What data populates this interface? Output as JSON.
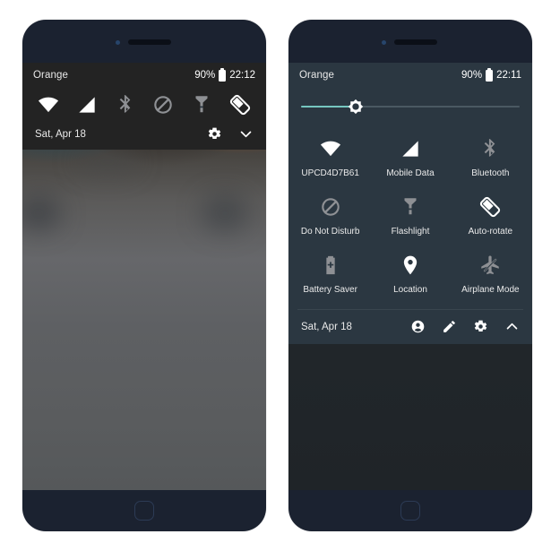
{
  "phones": {
    "left": {
      "name": "collapsed-quick-settings",
      "statusbar": {
        "carrier": "Orange",
        "battery_percent": "90%",
        "battery_icon": "battery-icon",
        "clock": "22:12"
      },
      "quick_icons": [
        {
          "name": "wifi-icon",
          "label": "Wi-Fi",
          "active": true
        },
        {
          "name": "signal-icon",
          "label": "Mobile Data",
          "active": true
        },
        {
          "name": "bluetooth-icon",
          "label": "Bluetooth",
          "active": false
        },
        {
          "name": "do-not-disturb-icon",
          "label": "Do Not Disturb",
          "active": false
        },
        {
          "name": "flashlight-icon",
          "label": "Flashlight",
          "active": false
        },
        {
          "name": "auto-rotate-icon",
          "label": "Auto-rotate",
          "active": true
        }
      ],
      "footer": {
        "date": "Sat, Apr 18",
        "actions": [
          {
            "name": "gear-icon",
            "label": "Settings"
          },
          {
            "name": "chevron-down-icon",
            "label": "Expand"
          }
        ]
      }
    },
    "right": {
      "name": "expanded-quick-settings",
      "statusbar": {
        "carrier": "Orange",
        "battery_percent": "90%",
        "battery_icon": "battery-icon",
        "clock": "22:11"
      },
      "brightness": {
        "name": "brightness-slider",
        "icon": "brightness-sun-icon",
        "value_percent": 25
      },
      "tiles": [
        {
          "name": "tile-wifi",
          "icon": "wifi-icon",
          "label": "UPCD4D7B61",
          "active": true
        },
        {
          "name": "tile-mobile-data",
          "icon": "signal-icon",
          "label": "Mobile Data",
          "active": true
        },
        {
          "name": "tile-bluetooth",
          "icon": "bluetooth-icon",
          "label": "Bluetooth",
          "active": false
        },
        {
          "name": "tile-do-not-disturb",
          "icon": "do-not-disturb-icon",
          "label": "Do Not Disturb",
          "active": false
        },
        {
          "name": "tile-flashlight",
          "icon": "flashlight-icon",
          "label": "Flashlight",
          "active": false
        },
        {
          "name": "tile-auto-rotate",
          "icon": "auto-rotate-icon",
          "label": "Auto-rotate",
          "active": true
        },
        {
          "name": "tile-battery-saver",
          "icon": "battery-saver-icon",
          "label": "Battery Saver",
          "active": false
        },
        {
          "name": "tile-location",
          "icon": "location-pin-icon",
          "label": "Location",
          "active": true
        },
        {
          "name": "tile-airplane-mode",
          "icon": "airplane-mode-icon",
          "label": "Airplane Mode",
          "active": false
        }
      ],
      "footer": {
        "date": "Sat, Apr 18",
        "actions": [
          {
            "name": "user-account-icon",
            "label": "User"
          },
          {
            "name": "edit-pencil-icon",
            "label": "Edit"
          },
          {
            "name": "gear-icon",
            "label": "Settings"
          },
          {
            "name": "chevron-up-icon",
            "label": "Collapse"
          }
        ]
      }
    }
  },
  "colors": {
    "panel_left_bg": "#232323",
    "panel_right_bg": "#2b3741",
    "frame": "#1b2230",
    "icon_active": "#ffffff",
    "icon_inactive": "#8e9094",
    "slider_fill": "#76c7c0",
    "slider_track": "#4a5962",
    "page_bg": "#ffffff"
  }
}
